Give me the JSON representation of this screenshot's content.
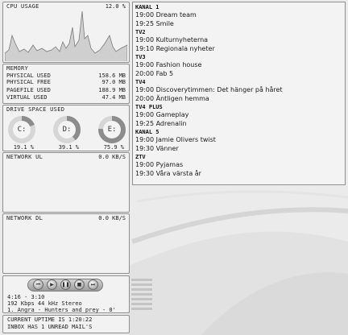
{
  "cpu": {
    "title": "CPU USAGE",
    "value": "12.0 %"
  },
  "memory": {
    "title": "MEMORY",
    "rows": [
      {
        "label": "PHYSICAL USED",
        "value": "158.6 MB"
      },
      {
        "label": "PHYSICAL FREE",
        "value": "97.0 MB"
      },
      {
        "label": "PAGEFILE USED",
        "value": "188.9 MB"
      },
      {
        "label": "VIRTUAL USED",
        "value": "47.4 MB"
      }
    ]
  },
  "drives": {
    "title": "DRIVE SPACE USED",
    "items": [
      {
        "letter": "C:",
        "percent": "19.1 %",
        "used": 0.191
      },
      {
        "letter": "D:",
        "percent": "39.1 %",
        "used": 0.391
      },
      {
        "letter": "E:",
        "percent": "75.9 %",
        "used": 0.759
      }
    ]
  },
  "network_ul": {
    "title": "NETWORK UL",
    "value": "0.0 KB/S"
  },
  "network_dl": {
    "title": "NETWORK DL",
    "value": "0.0 KB/S"
  },
  "media": {
    "time": "4:16 - 3:10",
    "format": "192 Kbps 44 kHz Stereo",
    "track": "1. Angra - Hunters and prey - 0'"
  },
  "status": {
    "uptime": "CURRENT UPTIME IS 1:20:22",
    "mail": "INBOX HAS 1 UNREAD MAIL'S"
  },
  "tv": [
    {
      "channel": "KANAL 1",
      "shows": [
        "19:00 Dream team",
        "19:25 Smile"
      ]
    },
    {
      "channel": "TV2",
      "shows": [
        "19:00 Kulturnyheterna",
        "19:10 Regionala nyheter"
      ]
    },
    {
      "channel": "TV3",
      "shows": [
        "19:00 Fashion house",
        "20:00 Fab 5"
      ]
    },
    {
      "channel": "TV4",
      "shows": [
        "19:00 Discoverytimmen: Det hänger på håret",
        "20:00 Äntligen hemma"
      ]
    },
    {
      "channel": "TV4 Plus",
      "shows": [
        "19:00 Gameplay",
        "19:25 Adrenalin"
      ]
    },
    {
      "channel": "KANAL 5",
      "shows": [
        "19:00 Jamie Olivers twist",
        "19:30 Vänner"
      ]
    },
    {
      "channel": "ZTV",
      "shows": [
        "19:00 Pyjamas",
        "19:30 Våra värsta år"
      ]
    }
  ]
}
